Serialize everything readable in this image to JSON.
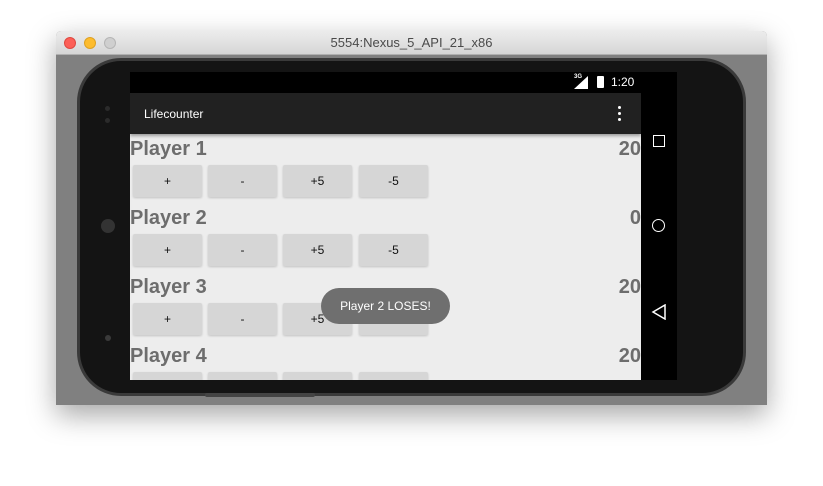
{
  "window": {
    "title": "5554:Nexus_5_API_21_x86"
  },
  "status": {
    "network": "3G",
    "time": "1:20"
  },
  "app": {
    "title": "Lifecounter"
  },
  "buttons": {
    "plus": "+",
    "minus": "-",
    "plus5": "+5",
    "minus5": "-5"
  },
  "players": [
    {
      "name": "Player 1",
      "life": "20"
    },
    {
      "name": "Player 2",
      "life": "0"
    },
    {
      "name": "Player 3",
      "life": "20"
    },
    {
      "name": "Player 4",
      "life": "20"
    }
  ],
  "toast": {
    "message": "Player 2 LOSES!"
  }
}
